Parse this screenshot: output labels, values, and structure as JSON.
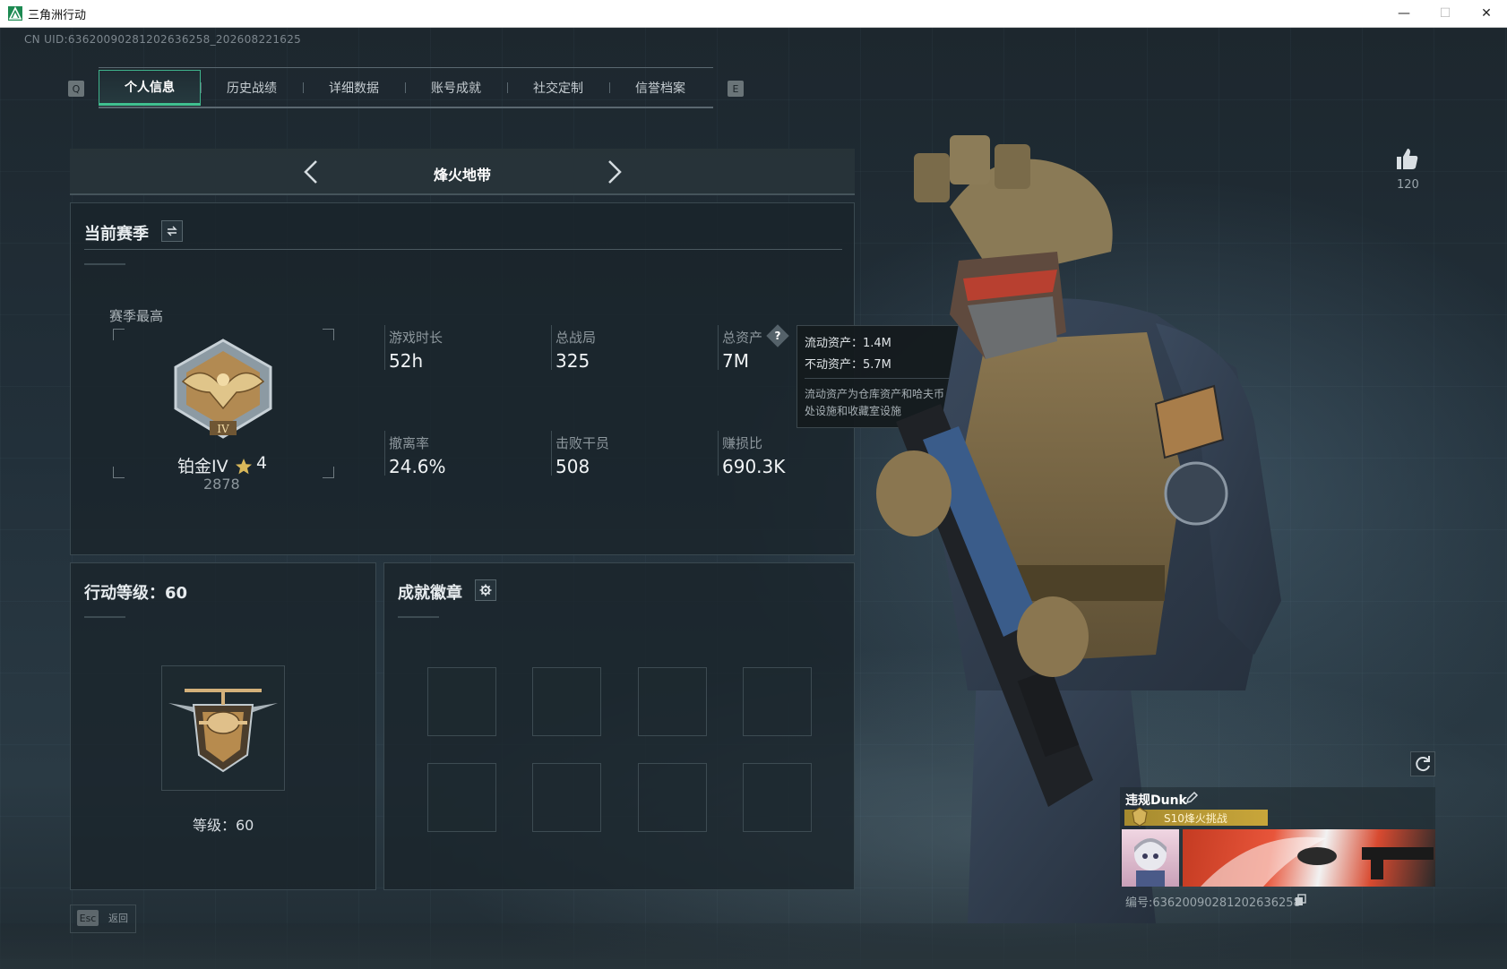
{
  "window": {
    "title": "三角洲行动",
    "controls": {
      "minimize": "—",
      "maximize": "☐",
      "close": "✕"
    }
  },
  "uid_text": "CN UID:6362009028120263​6258_202608221625",
  "tabs": {
    "left_key": "Q",
    "right_key": "E",
    "items": [
      "个人信息",
      "历史战绩",
      "详细数据",
      "账号成就",
      "社交定制",
      "信誉档案"
    ],
    "active_index": 0
  },
  "mode": {
    "title": "烽火地带"
  },
  "current_season": {
    "title": "当前赛季",
    "best_label": "赛季最高",
    "rank_name": "铂金IV",
    "rank_stars": "4",
    "rank_points": "2878",
    "stats": [
      {
        "label": "游戏时长",
        "value": "52h"
      },
      {
        "label": "总战局",
        "value": "325"
      },
      {
        "label": "总资产",
        "value": "7M"
      },
      {
        "label": "撤离率",
        "value": "24.6%"
      },
      {
        "label": "击败干员",
        "value": "508"
      },
      {
        "label": "赚损比",
        "value": "690.3K"
      }
    ]
  },
  "asset_tooltip": {
    "liquid": "流动资产：1.4M",
    "fixed": "不动资产：5.7M",
    "note": "流动资产为仓库资产和哈夫币，不动资产为特勤处设施和收藏室设施"
  },
  "action_level": {
    "title": "行动等级：60",
    "caption": "等级：60"
  },
  "badges": {
    "title": "成就徽章",
    "slots": 8
  },
  "player": {
    "name": "违规Dunk",
    "season_tag": "S10烽火挑战",
    "id_text": "编号:6362009028120263​6258",
    "likes": "120"
  },
  "footer": {
    "esc_key": "Esc",
    "back_label": "返回"
  },
  "colors": {
    "accent": "#40c090",
    "gold": "#c9a63a"
  }
}
